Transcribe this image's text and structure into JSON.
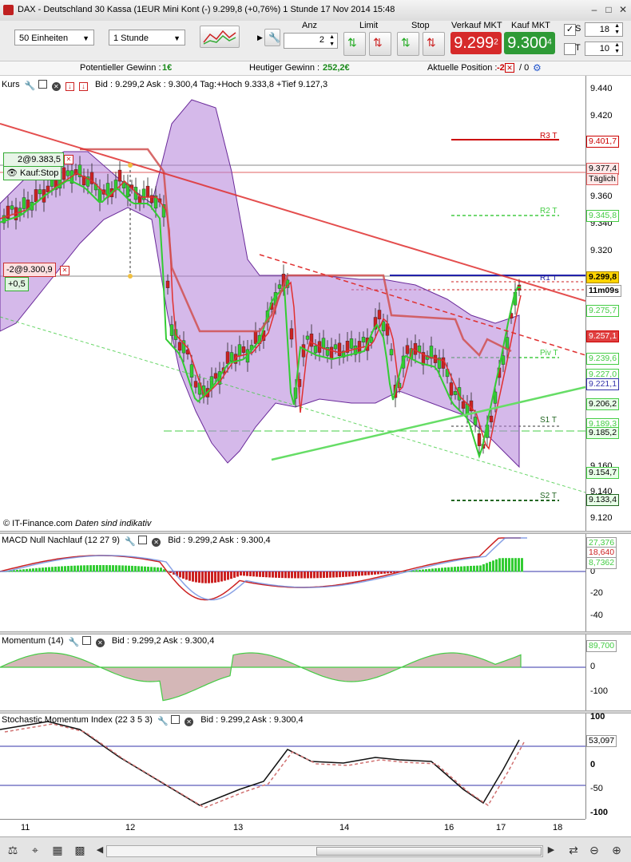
{
  "window": {
    "title": "DAX - Deutschland 30 Kassa (1EUR Mini Kont (-)    9.299,8 (+0,76%)    1 Stunde   17 Nov 2014 15:48"
  },
  "toolbar": {
    "units_value": "50 Einheiten",
    "interval_value": "1 Stunde",
    "anz_label": "Anz",
    "anz_value": "2",
    "limit_label": "Limit",
    "stop_label": "Stop",
    "sell_label": "Verkauf MKT",
    "sell_price_main": "9.299",
    "sell_price_small": "2",
    "buy_label": "Kauf MKT",
    "buy_price_main": "9.300",
    "buy_price_small": "4",
    "s_label": "S",
    "s_value": "18",
    "t_label": "T",
    "t_value": "10"
  },
  "infobar": {
    "potential_label": "Potentieller Gewinn :",
    "potential_value": "1€",
    "today_label": "Heutiger Gewinn :",
    "today_value": "252,2€",
    "position_label": "Aktuelle Position :",
    "position_value": "-2",
    "position_sep": "/  0"
  },
  "main_panel": {
    "name": "Kurs",
    "info": "Bid : 9.299,2 Ask : 9.300,4 Tag:+Hoch 9.333,8 +Tief 9.127,3",
    "footer": "© IT-Finance.com",
    "footer_note": "Daten sind indikativ",
    "order1": "2@9.383,5",
    "order1_type": "Kauf:Stop",
    "order2": "-2@9.300,9",
    "order2_pl": "+0,5",
    "y_ticks": [
      "9.440",
      "9.420",
      "9.400",
      "9.380",
      "9.360",
      "9.340",
      "9.320",
      "9.300",
      "9.280",
      "9.260",
      "9.240",
      "9.220",
      "9.200",
      "9.180",
      "9.160",
      "9.140",
      "9.120"
    ],
    "levels": [
      {
        "label": "R3 T",
        "value": "9.401,7",
        "color": "#cc0000"
      },
      {
        "label": "",
        "value": "9.377,4",
        "color": "#e06060"
      },
      {
        "label": "",
        "value": "Täglich",
        "color": "#e06060"
      },
      {
        "label": "R2 T",
        "value": "9.345,8",
        "color": "#44cc44"
      },
      {
        "label": "R1 T",
        "value": "9.299,8",
        "color": "#2222aa"
      },
      {
        "label": "",
        "value": "11m09s",
        "color": "#000"
      },
      {
        "label": "",
        "value": "9.275,7",
        "color": "#44cc44"
      },
      {
        "label": "",
        "value": "9.257,1",
        "color": "#e04040"
      },
      {
        "label": "Piv T",
        "value": "9.239,6",
        "color": "#44cc44"
      },
      {
        "label": "",
        "value": "9.227,0",
        "color": "#44cc44"
      },
      {
        "label": "",
        "value": "9.221,1",
        "color": "#3333aa"
      },
      {
        "label": "",
        "value": "9.206,2",
        "color": "#44cc44"
      },
      {
        "label": "",
        "value": "9.189,3",
        "color": "#44cc44"
      },
      {
        "label": "S1 T",
        "value": "9.185,2",
        "color": "#44cc44"
      },
      {
        "label": "",
        "value": "9.154,7",
        "color": "#44cc44"
      },
      {
        "label": "S2 T",
        "value": "9.133,4",
        "color": "#226622"
      }
    ]
  },
  "macd_panel": {
    "name": "MACD Null Nachlauf (12 27 9)",
    "info": "Bid : 9.299,2 Ask : 9.300,4",
    "values": [
      "27,376",
      "18,640",
      "8,7362"
    ],
    "y_ticks": [
      "20",
      "0",
      "-20",
      "-40"
    ]
  },
  "momentum_panel": {
    "name": "Momentum (14)",
    "info": "Bid : 9.299,2 Ask : 9.300,4",
    "value": "89,700",
    "y_ticks": [
      "0",
      "-100"
    ]
  },
  "smi_panel": {
    "name": "Stochastic Momentum Index (22 3 5 3)",
    "info": "Bid : 9.299,2 Ask : 9.300,4",
    "value": "53,097",
    "y_ticks": [
      "100",
      "0",
      "-50",
      "-100"
    ]
  },
  "x_axis": {
    "labels": [
      "11",
      "12",
      "13",
      "14",
      "16",
      "17",
      "18"
    ]
  },
  "colors": {
    "sell": "#d62a2a",
    "buy": "#2e9a36",
    "band_fill": "#b380d8",
    "candle_up": "#33cc33",
    "candle_down": "#cc2222"
  }
}
